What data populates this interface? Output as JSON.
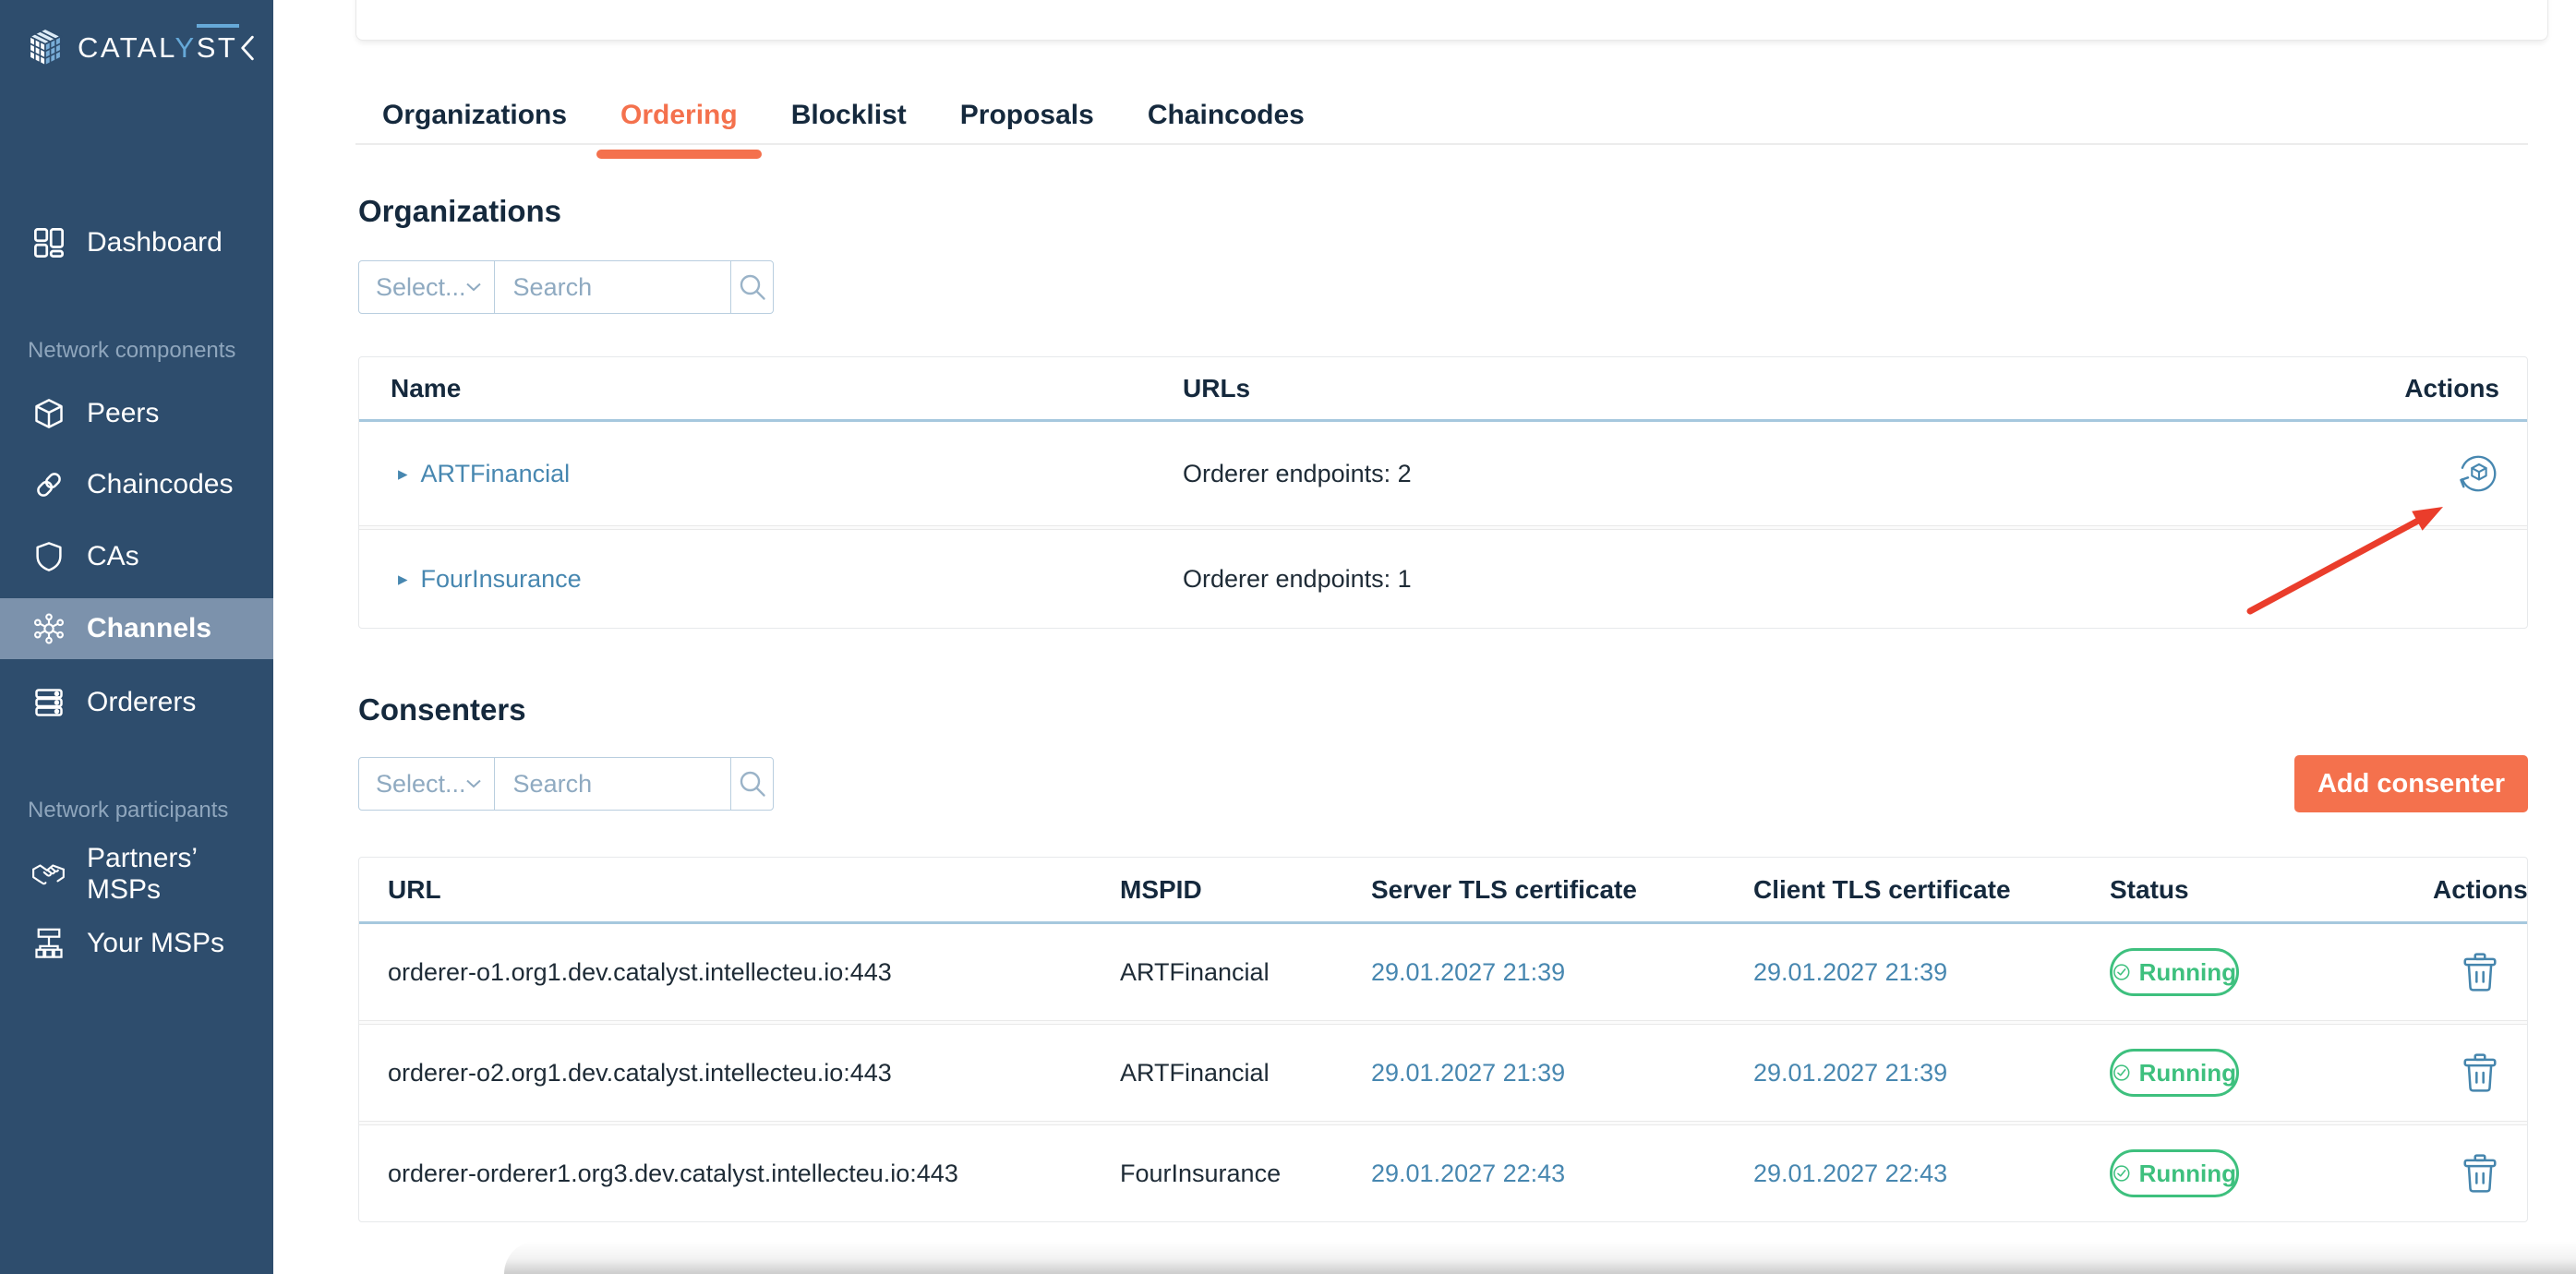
{
  "colors": {
    "sidebar_bg": "#2E4D6D",
    "sidebar_active_bg": "#7C92AC",
    "accent_orange": "#F4714D",
    "link_blue": "#4787B0",
    "success_green": "#3EC07E",
    "heading_navy": "#15293D",
    "table_header_underline": "#A6C8DE",
    "annotation_red": "#EA3D2B"
  },
  "icons": {
    "logo-cube-icon": "pixel-cube",
    "collapse-icon": "chevron-left",
    "dashboard-icon": "grid",
    "peers-icon": "cube",
    "chaincodes-icon": "chain-link",
    "cas-icon": "shield",
    "channels-icon": "hub-nodes",
    "orderers-icon": "server-stack",
    "partners-msps-icon": "handshake",
    "your-msps-icon": "sitemap",
    "select-chevron-icon": "chevron-down",
    "search-icon": "magnifier",
    "row-caret-icon": "▸",
    "update-cube-icon": "cube-with-circular-arrow",
    "running-check-icon": "check-circle",
    "delete-icon": "trash"
  },
  "sidebar": {
    "logo": {
      "part1": "CATAL",
      "accent": "Y",
      "part2": "ST"
    },
    "section_labels": {
      "components": "Network components",
      "participants": "Network participants"
    },
    "items": [
      {
        "label": "Dashboard"
      },
      {
        "label": "Peers"
      },
      {
        "label": "Chaincodes"
      },
      {
        "label": "CAs"
      },
      {
        "label": "Channels",
        "active": true
      },
      {
        "label": "Orderers"
      },
      {
        "label": "Partners’ MSPs"
      },
      {
        "label": "Your MSPs"
      }
    ]
  },
  "tabs": {
    "items": [
      {
        "label": "Organizations"
      },
      {
        "label": "Ordering",
        "active": true
      },
      {
        "label": "Blocklist"
      },
      {
        "label": "Proposals"
      },
      {
        "label": "Chaincodes"
      }
    ]
  },
  "organizations": {
    "title": "Organizations",
    "filter": {
      "select_placeholder": "Select...",
      "search_placeholder": "Search"
    },
    "table": {
      "headers": {
        "name": "Name",
        "urls": "URLs",
        "actions": "Actions"
      },
      "rows": [
        {
          "name": "ARTFinancial",
          "urls": "Orderer endpoints: 2"
        },
        {
          "name": "FourInsurance",
          "urls": "Orderer endpoints: 1"
        }
      ]
    }
  },
  "consenters": {
    "title": "Consenters",
    "filter": {
      "select_placeholder": "Select...",
      "search_placeholder": "Search"
    },
    "add_button": "Add consenter",
    "table": {
      "headers": {
        "url": "URL",
        "mspid": "MSPID",
        "server_tls": "Server TLS certificate",
        "client_tls": "Client TLS certificate",
        "status": "Status",
        "actions": "Actions"
      },
      "rows": [
        {
          "url": "orderer-o1.org1.dev.catalyst.intellecteu.io:443",
          "mspid": "ARTFinancial",
          "server_tls": "29.01.2027 21:39",
          "client_tls": "29.01.2027 21:39",
          "status": "Running"
        },
        {
          "url": "orderer-o2.org1.dev.catalyst.intellecteu.io:443",
          "mspid": "ARTFinancial",
          "server_tls": "29.01.2027 21:39",
          "client_tls": "29.01.2027 21:39",
          "status": "Running"
        },
        {
          "url": "orderer-orderer1.org3.dev.catalyst.intellecteu.io:443",
          "mspid": "FourInsurance",
          "server_tls": "29.01.2027 22:43",
          "client_tls": "29.01.2027 22:43",
          "status": "Running"
        }
      ]
    }
  }
}
